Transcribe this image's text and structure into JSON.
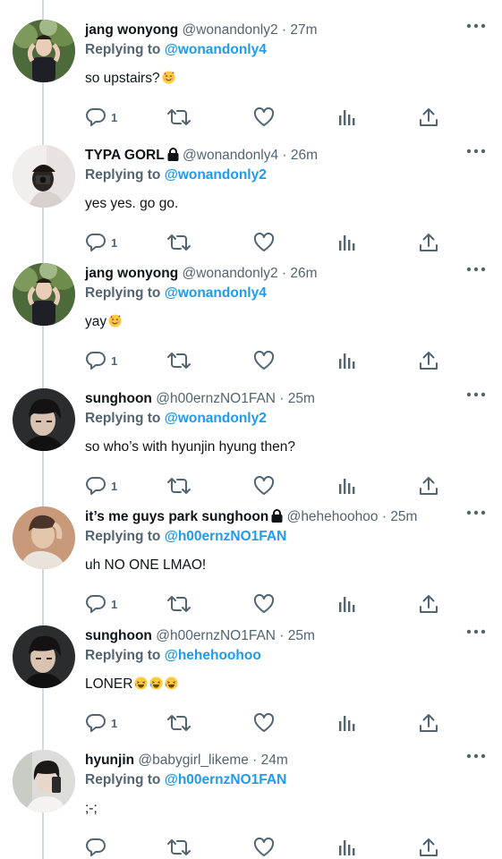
{
  "tweets": [
    {
      "name": "jang wonyong",
      "locked": false,
      "handle": "@wonandonly2",
      "time": "27m",
      "reply_prefix": "Replying to",
      "reply_to": "@wonandonly4",
      "text": "so upstairs?",
      "emoji": "🥰",
      "emoji_count": 1,
      "reply_count": "1",
      "avatar": "avatar-wonyong"
    },
    {
      "name": "TYPA GORL",
      "locked": true,
      "handle": "@wonandonly4",
      "time": "26m",
      "reply_prefix": "Replying to",
      "reply_to": "@wonandonly2",
      "text": "yes yes. go go.",
      "emoji": "",
      "emoji_count": 0,
      "reply_count": "1",
      "avatar": "avatar-typa"
    },
    {
      "name": "jang wonyong",
      "locked": false,
      "handle": "@wonandonly2",
      "time": "26m",
      "reply_prefix": "Replying to",
      "reply_to": "@wonandonly4",
      "text": "yay",
      "emoji": "🥰",
      "emoji_count": 1,
      "reply_count": "1",
      "avatar": "avatar-wonyong"
    },
    {
      "name": "sunghoon",
      "locked": false,
      "handle": "@h00ernzNO1FAN",
      "time": "25m",
      "reply_prefix": "Replying to",
      "reply_to": "@wonandonly2",
      "text": "so who’s with hyunjin hyung then?",
      "emoji": "",
      "emoji_count": 0,
      "reply_count": "1",
      "avatar": "avatar-sunghoon"
    },
    {
      "name": "it’s me guys park sunghoon",
      "locked": true,
      "handle": "@hehehoohoo",
      "time": "25m",
      "reply_prefix": "Replying to",
      "reply_to": "@h00ernzNO1FAN",
      "text": "uh NO ONE LMAO!",
      "emoji": "",
      "emoji_count": 0,
      "reply_count": "1",
      "avatar": "avatar-park"
    },
    {
      "name": "sunghoon",
      "locked": false,
      "handle": "@h00ernzNO1FAN",
      "time": "25m",
      "reply_prefix": "Replying to",
      "reply_to": "@hehehoohoo",
      "text": "LONER",
      "emoji": "🤣",
      "emoji_count": 3,
      "reply_count": "1",
      "avatar": "avatar-sunghoon"
    },
    {
      "name": "hyunjin",
      "locked": false,
      "handle": "@babygirl_likeme",
      "time": "24m",
      "reply_prefix": "Replying to",
      "reply_to": "@h00ernzNO1FAN",
      "text": ";-;",
      "emoji": "",
      "emoji_count": 0,
      "reply_count": "",
      "avatar": "avatar-hyunjin"
    }
  ],
  "separator": " · ",
  "colors": {
    "text": "#0f1419",
    "muted": "#536471",
    "link": "#1d9bf0",
    "line": "#cfd9de"
  },
  "icons": [
    "reply-icon",
    "retweet-icon",
    "like-icon",
    "views-icon",
    "share-icon",
    "more-icon",
    "lock-icon"
  ]
}
